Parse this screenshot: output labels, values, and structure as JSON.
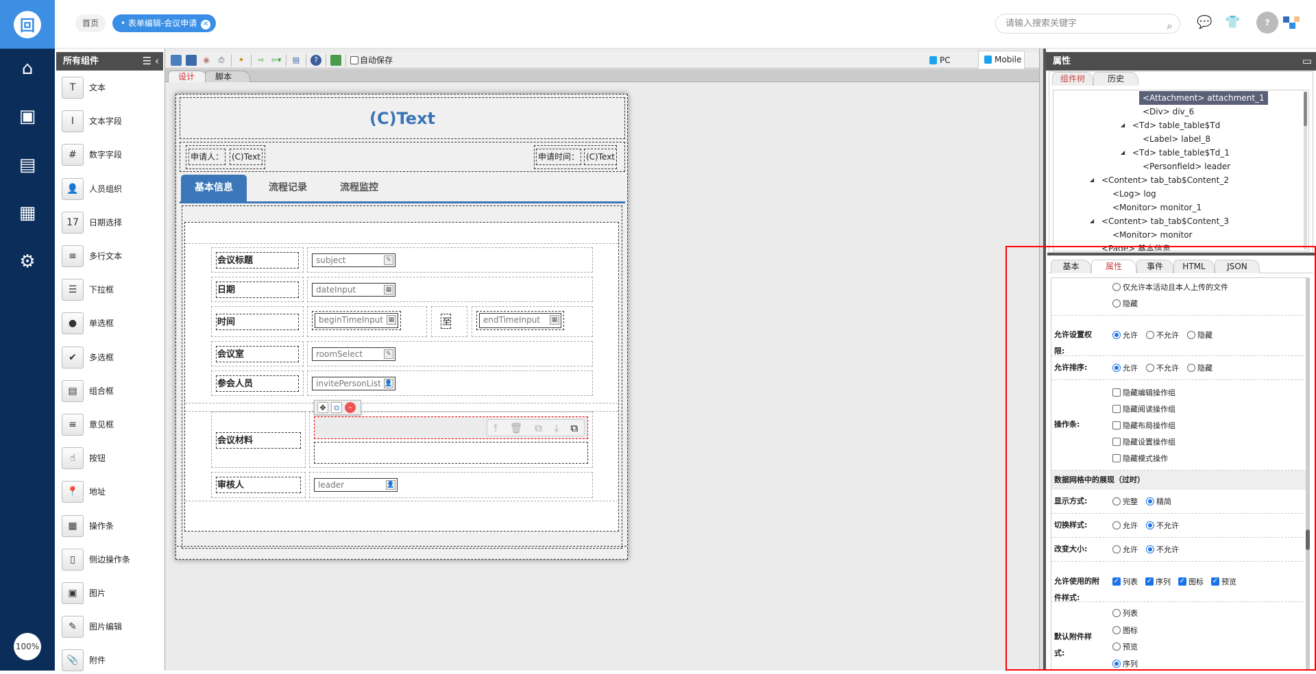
{
  "app": {
    "logo_icon": "app-logo-icon",
    "zoom": "100%"
  },
  "sidebar": {
    "icons": [
      "home-icon",
      "monitor-user-icon",
      "news-icon",
      "calendar-icon",
      "user-settings-icon"
    ]
  },
  "header": {
    "home": "首页",
    "current_tab": "表单编辑-会议申请",
    "close": "✕",
    "search_placeholder": "请输入搜索关键字"
  },
  "components": {
    "title": "所有组件",
    "items": [
      {
        "label": "文本",
        "icon": "T"
      },
      {
        "label": "文本字段",
        "icon": "I"
      },
      {
        "label": "数字字段",
        "icon": "#"
      },
      {
        "label": "人员组织",
        "icon": "👤"
      },
      {
        "label": "日期选择",
        "icon": "17"
      },
      {
        "label": "多行文本",
        "icon": "≡"
      },
      {
        "label": "下拉框",
        "icon": "☰"
      },
      {
        "label": "单选框",
        "icon": "●"
      },
      {
        "label": "多选框",
        "icon": "✔"
      },
      {
        "label": "组合框",
        "icon": "▤"
      },
      {
        "label": "意见框",
        "icon": "≡"
      },
      {
        "label": "按钮",
        "icon": "☝"
      },
      {
        "label": "地址",
        "icon": "📍"
      },
      {
        "label": "操作条",
        "icon": "▦"
      },
      {
        "label": "侧边操作条",
        "icon": "▯"
      },
      {
        "label": "图片",
        "icon": "▣"
      },
      {
        "label": "图片编辑",
        "icon": "✎"
      },
      {
        "label": "附件",
        "icon": "📎"
      }
    ]
  },
  "toolbar": {
    "autosave": "自动保存",
    "pc": "PC",
    "mobile": "Mobile",
    "tabs": [
      "设计",
      "脚本"
    ]
  },
  "form": {
    "title": "(C)Text",
    "applicant_label": "申请人：",
    "applicant_value": "(C)Text",
    "time_label": "申请时间：",
    "time_value": "(C)Text",
    "tabs": [
      "基本信息",
      "流程记录",
      "流程监控"
    ],
    "rows": {
      "subject_label": "会议标题",
      "subject": "subject",
      "date_label": "日期",
      "date": "dateInput",
      "time_label": "时间",
      "begin": "beginTimeInput",
      "to": "至",
      "end": "endTimeInput",
      "room_label": "会议室",
      "room": "roomSelect",
      "invite_label": "参会人员",
      "invite": "invitePersonList",
      "material_label": "会议材料",
      "reviewer_label": "审核人",
      "reviewer": "leader"
    }
  },
  "props": {
    "title": "属性",
    "tree_tabs": [
      "组件树",
      "历史"
    ],
    "tree": [
      {
        "text": "<Attachment> attachment_1",
        "level": 4,
        "selected": true
      },
      {
        "text": "<Div> div_6",
        "level": 4
      },
      {
        "text": "<Td> table_table$Td",
        "level": 3,
        "expand": true
      },
      {
        "text": "<Label> label_8",
        "level": 4
      },
      {
        "text": "<Td> table_table$Td_1",
        "level": 3,
        "expand": true
      },
      {
        "text": "<Personfield> leader",
        "level": 4
      },
      {
        "text": "<Content> tab_tab$Content_2",
        "level": 1,
        "expand": true
      },
      {
        "text": "<Log> log",
        "level": 2
      },
      {
        "text": "<Monitor> monitor_1",
        "level": 2
      },
      {
        "text": "<Content> tab_tab$Content_3",
        "level": 1,
        "expand": true
      },
      {
        "text": "<Monitor> monitor",
        "level": 2
      },
      {
        "text": "<Page> 基本信息",
        "level": 1
      }
    ],
    "tabs": [
      "基本",
      "属性",
      "事件",
      "HTML",
      "JSON"
    ],
    "opt_only_self": "仅允许本活动且本人上传的文件",
    "opt_hide": "隐藏",
    "perm_label": "允许设置权限:",
    "sort_label": "允许排序:",
    "allow": "允许",
    "deny": "不允许",
    "hide": "隐藏",
    "bar_label": "操作条:",
    "bar_opts": [
      "隐藏编辑操作组",
      "隐藏阅读操作组",
      "隐藏布局操作组",
      "隐藏设置操作组",
      "隐藏模式操作"
    ],
    "section": "数据网格中的展现（过时）",
    "display_label": "显示方式:",
    "full": "完整",
    "simple": "精简",
    "switch_label": "切换样式:",
    "resize_label": "改变大小:",
    "styles_label": "允许使用的附件样式:",
    "styles": [
      "列表",
      "序列",
      "图标",
      "预览"
    ],
    "default_label": "默认附件样式:",
    "defaults": [
      "列表",
      "图标",
      "预览",
      "序列"
    ]
  },
  "colors": {
    "accent": "#3b76b8",
    "sidebar": "#0b2d5a",
    "highlight": "#ff0000"
  }
}
